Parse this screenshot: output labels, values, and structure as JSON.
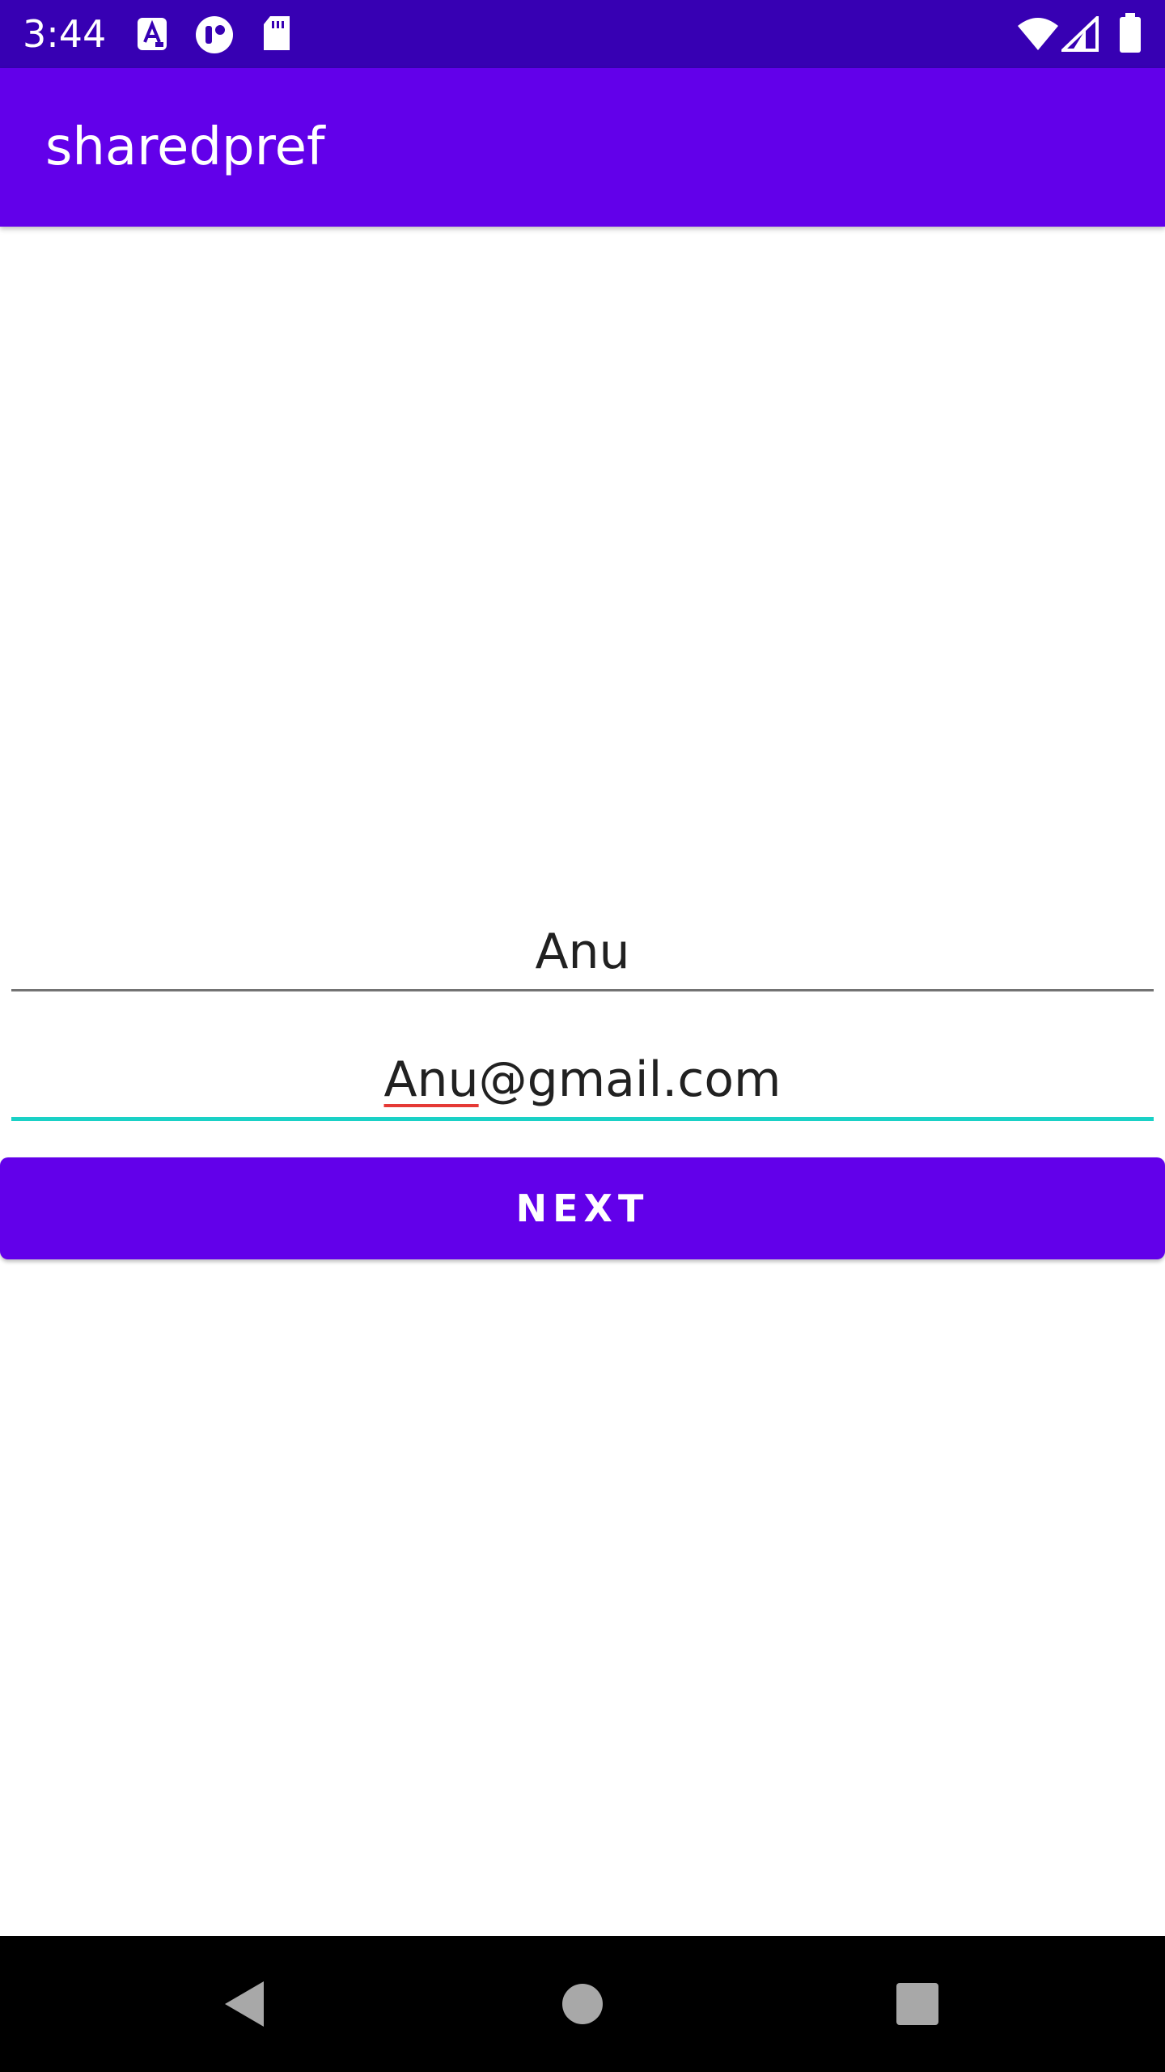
{
  "status_bar": {
    "time": "3:44",
    "left_icons": [
      "a-notification-icon",
      "circle-notification-icon",
      "sd-card-icon"
    ],
    "right_icons": [
      "wifi-icon",
      "signal-icon",
      "battery-icon"
    ]
  },
  "app_bar": {
    "title": "sharedpref",
    "color": "#6200ea"
  },
  "form": {
    "name_value": "Anu",
    "email_value_misspelled": "Anu",
    "email_value_rest": "@gmail.com",
    "focused_underline_color": "#1ad1c6"
  },
  "button": {
    "label": "NEXT",
    "color": "#6200ea"
  },
  "nav_bar": {
    "icons": [
      "back-icon",
      "home-icon",
      "recents-icon"
    ]
  }
}
